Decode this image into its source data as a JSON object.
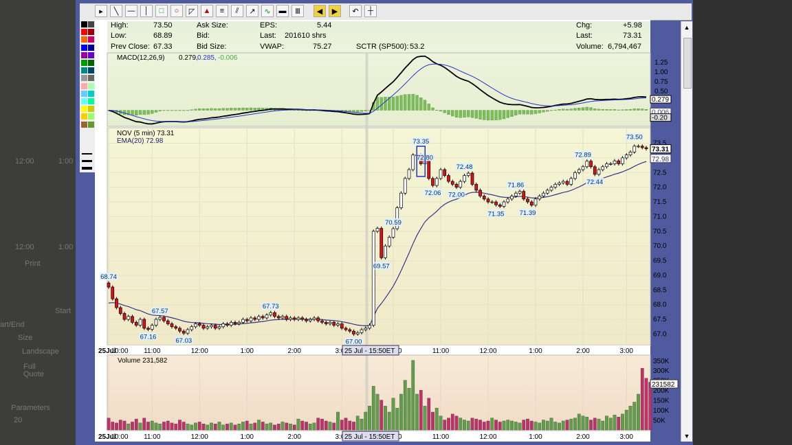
{
  "background": {
    "left_fragments": [
      "12:00",
      "1:00",
      "12:00",
      "1:00",
      "Print",
      "Start",
      "Size",
      "Landscape",
      "Full",
      "Quote",
      "Parameters",
      "20",
      "art/End"
    ]
  },
  "toolbar": {
    "icons": [
      "pointer-icon",
      "line-icon",
      "horizontal-line-icon",
      "vertical-line-icon",
      "rectangle-icon",
      "ellipse-icon",
      "callout-icon",
      "arrow-up-icon",
      "lines-icon",
      "channel-icon",
      "trend-tool-icon",
      "sine-icon",
      "bar-icon",
      "parallel-icon",
      "left-arrow-icon",
      "right-arrow-icon",
      "undo-icon",
      "crosshair-icon"
    ]
  },
  "palette": {
    "colors": [
      "#000000",
      "#444444",
      "#ff0000",
      "#990000",
      "#ff6600",
      "#cc0066",
      "#0000ff",
      "#000099",
      "#990099",
      "#6600cc",
      "#009900",
      "#006600",
      "#008888",
      "#004466",
      "#999999",
      "#666666",
      "#ffaaaa",
      "#aaffaa",
      "#66ccff",
      "#00cccc",
      "#66ffff",
      "#00ff99",
      "#ffff00",
      "#cccc00",
      "#ffcc00",
      "#99ff66",
      "#996633",
      "#669933"
    ]
  },
  "info_bar": {
    "high_label": "High:",
    "high": "73.50",
    "low_label": "Low:",
    "low": "68.89",
    "prev_label": "Prev Close:",
    "prev": "67.33",
    "ask_label": "Ask Size:",
    "bid_label": "Bid:",
    "bidsize_label": "Bid Size:",
    "eps_label": "EPS:",
    "eps": "5.44",
    "last_label": "Last:",
    "last_size": "201610 shrs",
    "vwap_label": "VWAP:",
    "vwap": "75.27",
    "sctr_label": "SCTR (SP500):",
    "sctr": "53.2",
    "chg_label": "Chg:",
    "chg": "+5.98",
    "last2_label": "Last:",
    "last2": "73.31",
    "vol_label": "Volume:",
    "vol": "6,794,467"
  },
  "chart_data": {
    "type": "candlestick",
    "symbol": "NOV",
    "interval": "5 min",
    "legend_price": "NOV (5 min) 73.31",
    "legend_ema": "EMA(20) 72.98",
    "crosshair_label": "25 Jul - 15:50ET",
    "day1_label": "25Jul",
    "x_ticks": [
      "10:00",
      "11:00",
      "12:00",
      "1:00",
      "2:00",
      "3:00",
      "10:00",
      "11:00",
      "12:00",
      "1:00",
      "2:00",
      "3:00"
    ],
    "y_ticks": [
      73.5,
      73.0,
      72.5,
      72.0,
      71.5,
      71.0,
      70.5,
      70.0,
      69.5,
      69.0,
      68.5,
      68.0,
      67.5,
      67.0
    ],
    "ylim": [
      66.8,
      73.7
    ],
    "close": [
      68.6,
      68.2,
      67.9,
      67.7,
      67.5,
      67.6,
      67.4,
      67.3,
      67.5,
      67.2,
      67.16,
      67.3,
      67.5,
      67.57,
      67.45,
      67.35,
      67.25,
      67.2,
      67.1,
      67.03,
      67.15,
      67.25,
      67.35,
      67.3,
      67.2,
      67.25,
      67.3,
      67.2,
      67.25,
      67.35,
      67.3,
      67.4,
      67.35,
      67.4,
      67.5,
      67.45,
      67.55,
      67.5,
      67.6,
      67.55,
      67.65,
      67.73,
      67.6,
      67.55,
      67.6,
      67.5,
      67.55,
      67.5,
      67.55,
      67.5,
      67.45,
      67.5,
      67.55,
      67.45,
      67.4,
      67.35,
      67.4,
      67.3,
      67.35,
      67.2,
      67.15,
      67.1,
      67.0,
      67.05,
      67.15,
      67.2,
      67.3,
      70.5,
      70.6,
      69.6,
      70.0,
      70.3,
      70.59,
      71.3,
      71.8,
      72.3,
      72.6,
      73.1,
      73.1,
      72.8,
      72.9,
      72.3,
      72.06,
      72.3,
      72.6,
      72.4,
      72.2,
      72.1,
      72.0,
      72.2,
      72.4,
      72.48,
      72.1,
      71.9,
      71.7,
      71.6,
      71.5,
      71.5,
      71.4,
      71.35,
      71.5,
      71.6,
      71.7,
      71.8,
      71.86,
      71.6,
      71.5,
      71.39,
      71.6,
      71.7,
      71.8,
      71.9,
      72.0,
      72.1,
      72.15,
      72.2,
      72.1,
      72.3,
      72.5,
      72.6,
      72.7,
      72.89,
      72.7,
      72.44,
      72.6,
      72.7,
      72.8,
      72.8,
      72.9,
      72.8,
      73.0,
      73.1,
      73.2,
      73.4,
      73.4,
      73.35,
      73.31
    ],
    "ema_start": 68.0,
    "annotations": [
      {
        "label": "68.74",
        "i": 0,
        "v": 68.74
      },
      {
        "label": "67.57",
        "i": 13,
        "v": 67.57
      },
      {
        "label": "67.16",
        "i": 10,
        "v": 67.16
      },
      {
        "label": "67.03",
        "i": 19,
        "v": 67.03
      },
      {
        "label": "67.73",
        "i": 41,
        "v": 67.73
      },
      {
        "label": "67.00",
        "i": 62,
        "v": 67.0
      },
      {
        "label": "70.59",
        "i": 72,
        "v": 70.59
      },
      {
        "label": "69.57",
        "i": 69,
        "v": 69.57
      },
      {
        "label": "73.35",
        "i": 79,
        "v": 73.35
      },
      {
        "label": "72.80",
        "i": 80,
        "v": 72.8
      },
      {
        "label": "72.06",
        "i": 82,
        "v": 72.06
      },
      {
        "label": "72.48",
        "i": 90,
        "v": 72.48
      },
      {
        "label": "72.00",
        "i": 88,
        "v": 72.0
      },
      {
        "label": "71.86",
        "i": 103,
        "v": 71.86
      },
      {
        "label": "71.35",
        "i": 98,
        "v": 71.35
      },
      {
        "label": "71.39",
        "i": 106,
        "v": 71.39
      },
      {
        "label": "72.89",
        "i": 120,
        "v": 72.89
      },
      {
        "label": "72.44",
        "i": 123,
        "v": 72.44
      },
      {
        "label": "73.50",
        "i": 133,
        "v": 73.5
      }
    ],
    "price_tags": [
      "73.31",
      "72.98"
    ],
    "macd": {
      "legend_name": "MACD(12,26,9)",
      "legend_values": [
        "0.279,",
        "0.285,",
        "-0.006"
      ],
      "y_ticks": [
        1.25,
        1.0,
        0.75,
        0.5,
        0.25
      ],
      "ylim": [
        -0.35,
        1.45
      ],
      "tags": [
        "0.279",
        "0.006",
        "-0.20"
      ]
    },
    "volume": {
      "legend": "Volume 231,582",
      "y_ticks": [
        "350K",
        "300K",
        "250K",
        "200K",
        "150K",
        "100K",
        "50K"
      ],
      "ylim": [
        0,
        370000
      ],
      "tag": "231582",
      "values": [
        60,
        40,
        35,
        50,
        45,
        30,
        40,
        55,
        35,
        60,
        40,
        45,
        35,
        30,
        40,
        45,
        35,
        30,
        50,
        40,
        30,
        25,
        35,
        40,
        30,
        25,
        35,
        30,
        40,
        25,
        30,
        35,
        25,
        30,
        40,
        45,
        30,
        35,
        50,
        40,
        30,
        35,
        25,
        30,
        40,
        35,
        30,
        25,
        55,
        45,
        40,
        30,
        35,
        60,
        55,
        45,
        40,
        35,
        90,
        50,
        60,
        45,
        40,
        70,
        55,
        90,
        120,
        220,
        180,
        150,
        120,
        90,
        160,
        110,
        180,
        250,
        210,
        350,
        180,
        200,
        120,
        160,
        90,
        110,
        70,
        50,
        60,
        80,
        70,
        60,
        50,
        45,
        60,
        55,
        50,
        40,
        45,
        60,
        50,
        40,
        45,
        50,
        45,
        40,
        35,
        50,
        55,
        45,
        40,
        35,
        50,
        45,
        60,
        40,
        35,
        45,
        50,
        55,
        60,
        80,
        70,
        65,
        50,
        60,
        55,
        45,
        70,
        60,
        75,
        65,
        80,
        100,
        120,
        140,
        180,
        310,
        260,
        240
      ]
    }
  },
  "scroll": {
    "up": "▲",
    "down": "▼"
  }
}
